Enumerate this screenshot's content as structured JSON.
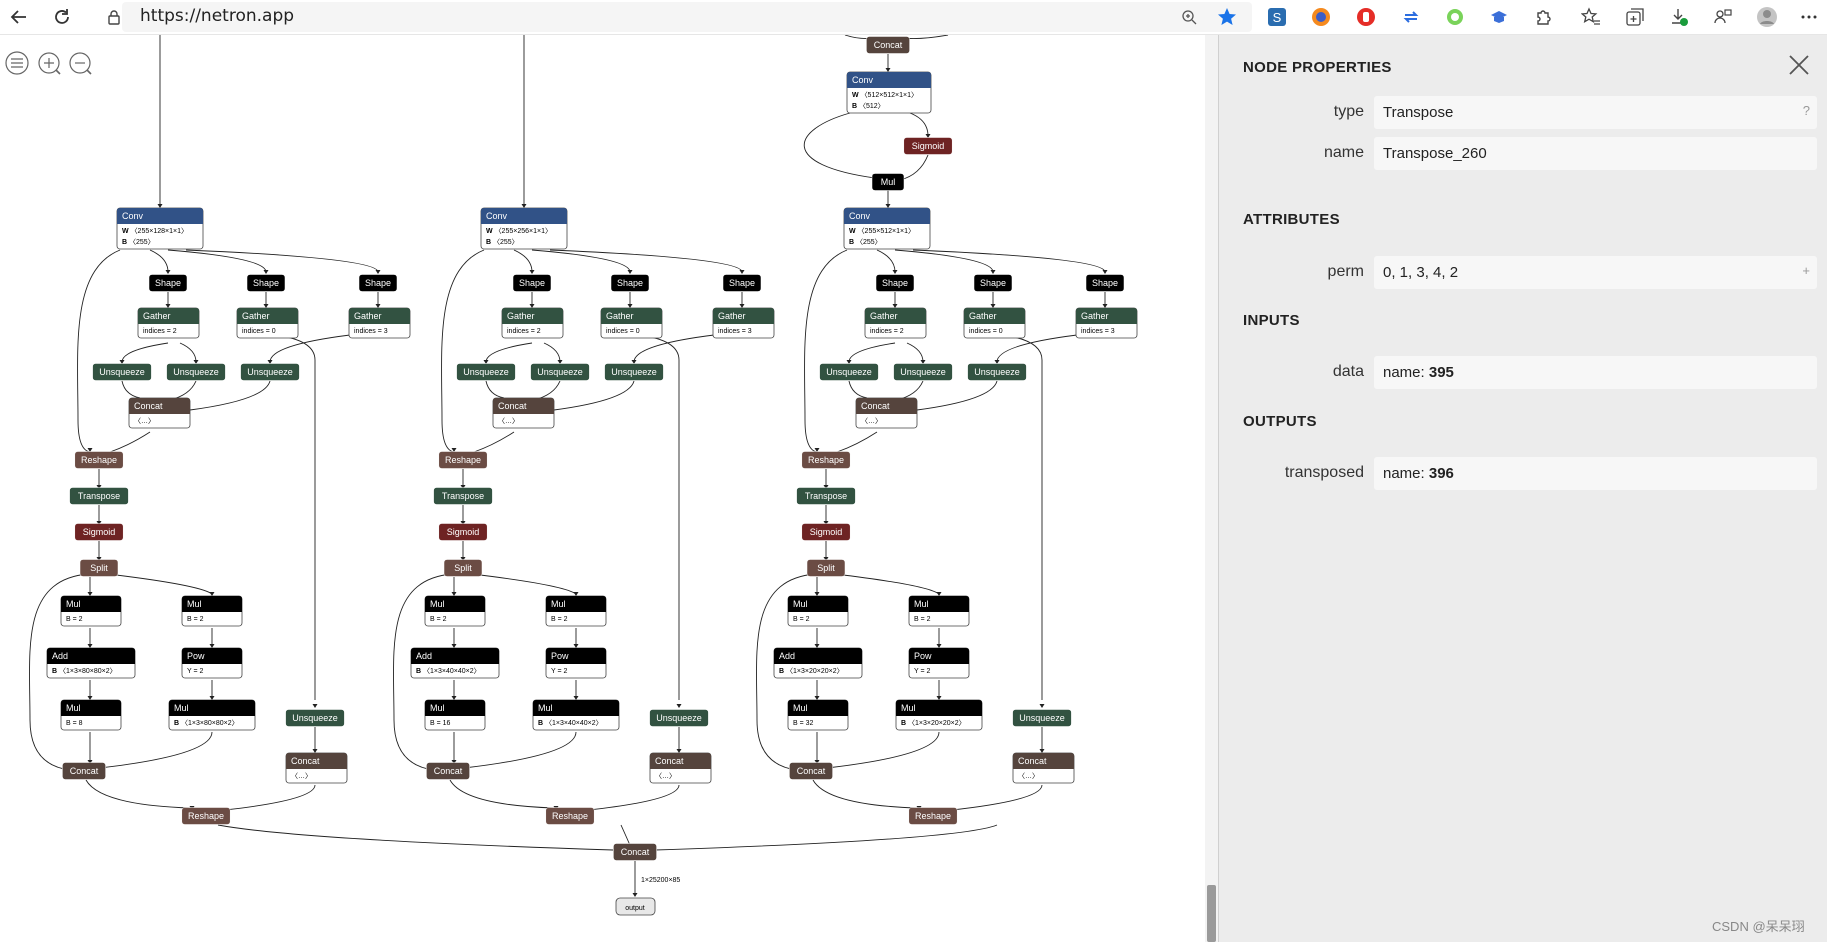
{
  "browser": {
    "url": "https://netron.app"
  },
  "panel": {
    "title": "NODE PROPERTIES",
    "props": [
      {
        "label": "type",
        "value": "Transpose",
        "hint": "?"
      },
      {
        "label": "name",
        "value": "Transpose_260",
        "hint": ""
      }
    ],
    "attributes_title": "ATTRIBUTES",
    "attributes": [
      {
        "label": "perm",
        "value": "0, 1, 3, 4, 2",
        "hint": "+"
      }
    ],
    "inputs_title": "INPUTS",
    "inputs": [
      {
        "label": "data",
        "prefix": "name: ",
        "value": "395"
      }
    ],
    "outputs_title": "OUTPUTS",
    "outputs": [
      {
        "label": "transposed",
        "prefix": "name: ",
        "value": "396"
      }
    ]
  },
  "watermark": "CSDN @呆呆珝",
  "colors": {
    "conv": "#315287",
    "shape": "#000000",
    "gather": "#325241",
    "concat": "#55443d",
    "reshape": "#6b4c44",
    "sigmoid": "#6e2323",
    "op": "#000000",
    "panel_bg": "#ececec"
  },
  "graph": {
    "top_concat": "Concat",
    "top_conv": {
      "label": "Conv",
      "w": "〈512×512×1×1〉",
      "b": "〈512〉"
    },
    "top_sigmoid": "Sigmoid",
    "top_mul": "Mul",
    "columns": [
      {
        "conv": {
          "label": "Conv",
          "w": "〈255×128×1×1〉",
          "b": "〈255〉"
        },
        "add_b": "〈1×3×80×80×2〉",
        "mul3_b": "B = 8",
        "mul4_b": "〈1×3×80×80×2〉"
      },
      {
        "conv": {
          "label": "Conv",
          "w": "〈255×256×1×1〉",
          "b": "〈255〉"
        },
        "add_b": "〈1×3×40×40×2〉",
        "mul3_b": "B = 16",
        "mul4_b": "〈1×3×40×40×2〉"
      },
      {
        "conv": {
          "label": "Conv",
          "w": "〈255×512×1×1〉",
          "b": "〈255〉"
        },
        "add_b": "〈1×3×20×20×2〉",
        "mul3_b": "B = 32",
        "mul4_b": "〈1×3×20×20×2〉"
      }
    ],
    "labels": {
      "shape": "Shape",
      "gather": "Gather",
      "idx2": "indices = 2",
      "idx0": "indices = 0",
      "idx3": "indices = 3",
      "unsqueeze": "Unsqueeze",
      "concat": "Concat",
      "ellipsis": "〈…〉",
      "reshape": "Reshape",
      "transpose": "Transpose",
      "sigmoid": "Sigmoid",
      "split": "Split",
      "mul": "Mul",
      "b2": "B = 2",
      "add": "Add",
      "pow": "Pow",
      "y2": "Y = 2",
      "final_concat": "Concat",
      "final_shape": "1×25200×85",
      "output": "output"
    }
  }
}
